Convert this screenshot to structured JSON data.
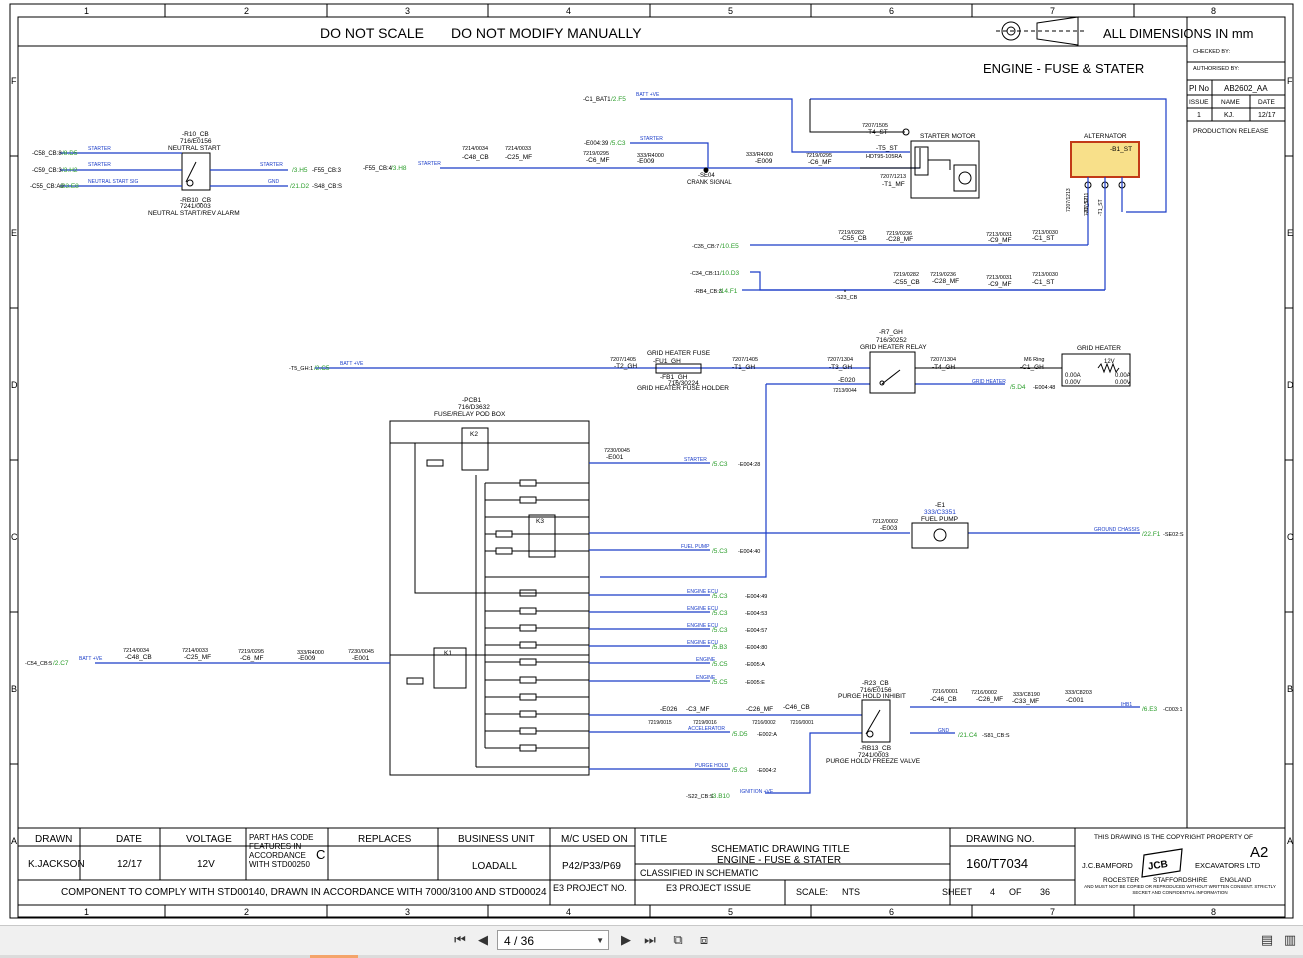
{
  "header": {
    "do_not_scale": "DO NOT SCALE",
    "do_not_modify": "DO NOT MODIFY MANUALLY",
    "dimensions": "ALL DIMENSIONS IN mm"
  },
  "grid": {
    "columns": [
      "1",
      "2",
      "3",
      "4",
      "5",
      "6",
      "7",
      "8"
    ],
    "rows": [
      "F",
      "E",
      "D",
      "C",
      "B",
      "A"
    ]
  },
  "revision": {
    "checked_by": "CHECKED BY:",
    "authorised_by": "AUTHORISED BY:",
    "pi_label": "PI No",
    "pi_value": "AB2602_AA",
    "issue_label": "ISSUE",
    "name_label": "NAME",
    "date_label": "DATE",
    "issue": "1",
    "name": "KJ.",
    "date": "12/17",
    "release": "PRODUCTION RELEASE"
  },
  "schematic": {
    "title": "ENGINE - FUSE & STATER",
    "neutral": {
      "id": "-R10_CB",
      "part": "716/E0156",
      "name": "NEUTRAL START",
      "id2": "-RB10_CB",
      "part2": "7241/0003",
      "name2": "NEUTRAL START/REV ALARM"
    },
    "neutral_refs": {
      "l1": "-C58_CB:8",
      "l1r": "/8.D5",
      "l1w": "STARTER",
      "l2": "-C59_CB:3",
      "l2r": "/3.H2",
      "l2w": "STARTER",
      "l3": "-C55_CB:A9",
      "l3r": "/23.E8",
      "l3w": "NEUTRAL START SIG",
      "r1": "/3.H5",
      "r1x": "-F55_CB:3",
      "r1w": "STARTER",
      "r2": "/21.D2",
      "r2x": "-S48_CB:S",
      "r2w": "GND"
    },
    "starter_line": {
      "src": "-F55_CB:4",
      "ref": "/3.H8",
      "wire": "STARTER",
      "c1a": "7214/0034",
      "c1": "-C48_CB",
      "c2a": "7214/0033",
      "c2": "-C25_MF",
      "c3a": "7219/0295",
      "c3": "-C6_MF",
      "e1": "-E004:39",
      "e1r": "/5.C3",
      "e1w": "STARTER",
      "c4a": "333/R4000",
      "c4": "-E009",
      "splice": "-SE04",
      "splice_name": "CRANK SIGNAL",
      "c5a": "333/R4000",
      "c5": "-E009",
      "c6a": "7219/0295",
      "c6": "-C6_MF"
    },
    "batt": {
      "src": "-C1_BAT1",
      "ref": "/2.F5",
      "wire": "BATT +VE"
    },
    "starter_motor": {
      "conn": "7207/1505",
      "id": "-T4_ST",
      "title": "STARTER MOTOR",
      "id2": "-T5_ST",
      "part": "HDT95-105RA",
      "c2a": "7207/1213",
      "c2": "-T1_MF"
    },
    "alternator": {
      "title": "ALTERNATOR",
      "id": "-B1_ST",
      "p1": "7207/1213",
      "p1b": "-T2_ST",
      "p2": "7207/1211",
      "p2b": "-T1_ST"
    },
    "alt_lines": {
      "l1": "-C35_CB:7",
      "l1r": "/10.E5",
      "c1a": "7219/0282",
      "c1": "-C55_CB",
      "c2a": "7219/0236",
      "c2": "-C28_MF",
      "c3a": "7213/0031",
      "c3": "-C9_MF",
      "c4a": "7213/0030",
      "c4": "-C1_ST",
      "l2": "-C34_CB:11",
      "l2r": "/10.D3",
      "l3": "-RB4_CB:3",
      "l3r": "/14.F1",
      "splice": "-S23_CB",
      "d1a": "7219/0282",
      "d1": "-C55_CB",
      "d2a": "7219/0236",
      "d2": "-C28_MF",
      "d3a": "7213/0031",
      "d3": "-C9_MF",
      "d4a": "7213/0030",
      "d4": "-C1_ST"
    },
    "grid_heater": {
      "src": "-T5_GH:1",
      "ref": "/2.C5",
      "wire": "BATT +VE",
      "fuse_title": "GRID HEATER FUSE",
      "fuse_id": "-FU1_GH",
      "holder_id": "-FB1_GH",
      "holder_part": "716/30224",
      "holder_name": "GRID HEATER FUSE HOLDER",
      "c1a": "7207/1405",
      "c1": "-T2_GH",
      "c2a": "7207/1405",
      "c2": "-T1_GH",
      "relay_id": "-R7_GH",
      "relay_part": "716/30252",
      "relay_name": "GRID HEATER RELAY",
      "c3a": "7207/1304",
      "c3": "-T3_GH",
      "c4a": "7207/1304",
      "c4": "-T4_GH",
      "e20": "-E020",
      "e20b": "7213/0044",
      "m6": "M6 Ring",
      "m6id": "-C1_GH",
      "heater_title": "GRID HEATER",
      "v12": "12V",
      "a1": "0.00A",
      "a2": "0.00V",
      "a3": "0.00A",
      "a4": "0.00V",
      "gh_ref": "/5.D4",
      "gh_wire": "GRID HEATER",
      "gh_e": "-E004:48"
    },
    "pcb": {
      "id": "-PCB1",
      "part": "716/D3632",
      "name": "FUSE/RELAY POD BOX",
      "k1": "K1",
      "k2": "K2",
      "k3": "K3"
    },
    "pcb_outputs": [
      {
        "pin": "N",
        "conn": "7230/0045",
        "e": "-E001",
        "wire": "STARTER",
        "ref": "/5.C3",
        "end": "-E004:28"
      },
      {
        "pin": "M",
        "conn": "",
        "e": "",
        "wire": "FUEL PUMP",
        "ref": "/5.C3",
        "end": "-E004:40"
      },
      {
        "pin": "X",
        "conn": "",
        "e": "",
        "wire": "ENGINE ECU",
        "ref": "/5.C3",
        "end": "-E004:49"
      },
      {
        "pin": "W",
        "conn": "",
        "e": "",
        "wire": "ENGINE ECU",
        "ref": "/5.C3",
        "end": "-E004:53"
      },
      {
        "pin": "V",
        "conn": "",
        "e": "",
        "wire": "ENGINE ECU",
        "ref": "/5.C3",
        "end": "-E004:57"
      },
      {
        "pin": "U",
        "conn": "",
        "e": "",
        "wire": "ENGINE ECU",
        "ref": "/5.B3",
        "end": "-E004:80"
      },
      {
        "pin": "T",
        "conn": "",
        "e": "",
        "wire": "ENGINE",
        "ref": "/5.C5",
        "end": "-E005:A"
      },
      {
        "pin": "S",
        "conn": "",
        "e": "",
        "wire": "ENGINE",
        "ref": "/5.C5",
        "end": "-E005:E"
      }
    ],
    "fuel_pump": {
      "id": "-E1",
      "part": "333/C3351",
      "name": "FUEL PUMP",
      "c1a": "7212/0002",
      "c1": "-E003",
      "wire": "GROUND CHASSIS",
      "ref": "/22.F1",
      "end": "-SE02:S"
    },
    "batt_in": {
      "src": "-C54_CB:5",
      "ref": "/2.C7",
      "wire": "BATT +VE",
      "c1a": "7214/0034",
      "c1": "-C48_CB",
      "c2a": "7214/0033",
      "c2": "-C25_MF",
      "c3a": "7219/0295",
      "c3": "-C6_MF",
      "c4a": "333/R4000",
      "c4": "-E009",
      "c5a": "7230/0045",
      "c5": "-E001"
    },
    "purge": {
      "id": "-R23_CB",
      "part": "716/E0156",
      "name": "PURGE HOLD INHIBIT",
      "id2": "-RB13_CB",
      "part2": "7241/0003",
      "name2": "PURGE HOLD/ FREEZE VALVE",
      "e26": "-E026",
      "c3": "-C3_MF",
      "c26": "-C26_MF",
      "c46": "-C46_CB",
      "a1": "7219/0015",
      "a2": "7219/0016",
      "a3": "7216/0002",
      "a4": "7216/0001",
      "b1a": "7216/0001",
      "b1": "-C46_CB",
      "b2a": "7216/0002",
      "b2": "-C26_MF",
      "b3a": "333/C8190",
      "b3": "-C33_MF",
      "b4a": "333/C8203",
      "b4": "-C001",
      "out_wire": "IHB1",
      "out_ref": "/6.E3",
      "out_end": "-C003:1",
      "gnd": "GND",
      "gnd_ref": "/21.C4",
      "gnd_end": "-S81_CB:S",
      "acc_wire": "ACCELERATOR",
      "acc_ref": "/5.D5",
      "acc_end": "-E002:A",
      "ph_wire": "PURGE HOLD",
      "ph_ref": "/5.C3",
      "ph_end": "-E004:2",
      "ign_src": "-S22_CB:S",
      "ign_ref": "/3.B10",
      "ign_wire": "IGNITION +VE"
    }
  },
  "title_block": {
    "drawn_label": "DRAWN",
    "date_label": "DATE",
    "voltage_label": "VOLTAGE",
    "partcode_label": "PART HAS CODE FEATURES IN ACCORDANCE WITH STD00250",
    "partcode_value": "C",
    "replaces_label": "REPLACES",
    "business_unit_label": "BUSINESS UNIT",
    "mc_label": "M/C USED ON",
    "title_label": "TITLE",
    "drawing_no_label": "DRAWING NO.",
    "drawn": "K.JACKSON",
    "date": "12/17",
    "voltage": "12V",
    "business_unit": "LOADALL",
    "mc": "P42/P33/P69",
    "title_1": "SCHEMATIC DRAWING TITLE",
    "title_2": "ENGINE - FUSE & STATER",
    "classified_label": "CLASSIFIED IN",
    "classified": "SCHEMATIC",
    "drawing_no": "160/T7034",
    "comply": "COMPONENT TO COMPLY WITH STD00140, DRAWN IN ACCORDANCE WITH 7000/3100 AND STD00024",
    "e3_project_no": "E3 PROJECT NO.",
    "e3_project_issue": "E3 PROJECT ISSUE",
    "scale_label": "SCALE:",
    "scale": "NTS",
    "sheet_label": "SHEET",
    "sheet": "4",
    "of_label": "OF",
    "total": "36",
    "copyright": "THIS DRAWING IS THE COPYRIGHT PROPERTY OF",
    "size": "A2",
    "company_1": "J.C.BAMFORD",
    "company_2": "EXCAVATORS LTD",
    "logo": "JCB",
    "addr_1": "ROCESTER",
    "addr_2": "STAFFORDSHIRE",
    "addr_3": "ENGLAND",
    "notice": "AND MUST NOT BE COPIED OR REPRODUCED WITHOUT WRITTEN CONSENT. STRICTLY SECRET AND CONFIDENTIAL INFORMATION"
  },
  "viewer": {
    "page_indicator": "4 / 36",
    "current_page": 4,
    "total_pages": 36,
    "first_icon": "first-page-icon",
    "prev_icon": "previous-page-icon",
    "next_icon": "next-page-icon",
    "last_icon": "last-page-icon",
    "accent": "#f4a46a"
  }
}
